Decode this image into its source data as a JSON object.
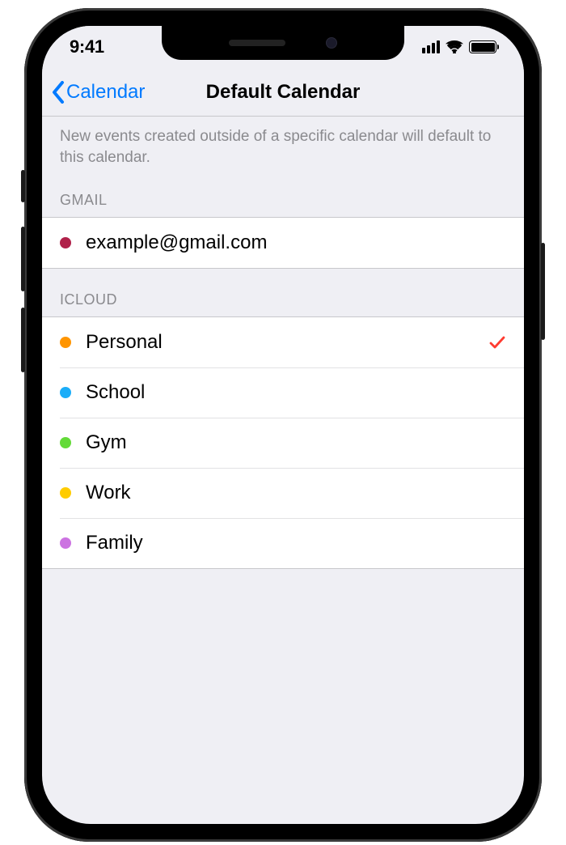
{
  "status": {
    "time": "9:41"
  },
  "nav": {
    "back_label": "Calendar",
    "title": "Default Calendar"
  },
  "description": "New events created outside of a specific calendar will default to this calendar.",
  "sections": [
    {
      "header": "GMAIL",
      "items": [
        {
          "label": "example@gmail.com",
          "color": "#b0214a",
          "selected": false
        }
      ]
    },
    {
      "header": "ICLOUD",
      "items": [
        {
          "label": "Personal",
          "color": "#ff9500",
          "selected": true
        },
        {
          "label": "School",
          "color": "#1badf8",
          "selected": false
        },
        {
          "label": "Gym",
          "color": "#63da38",
          "selected": false
        },
        {
          "label": "Work",
          "color": "#ffcc00",
          "selected": false
        },
        {
          "label": "Family",
          "color": "#cc73e1",
          "selected": false
        }
      ]
    }
  ]
}
